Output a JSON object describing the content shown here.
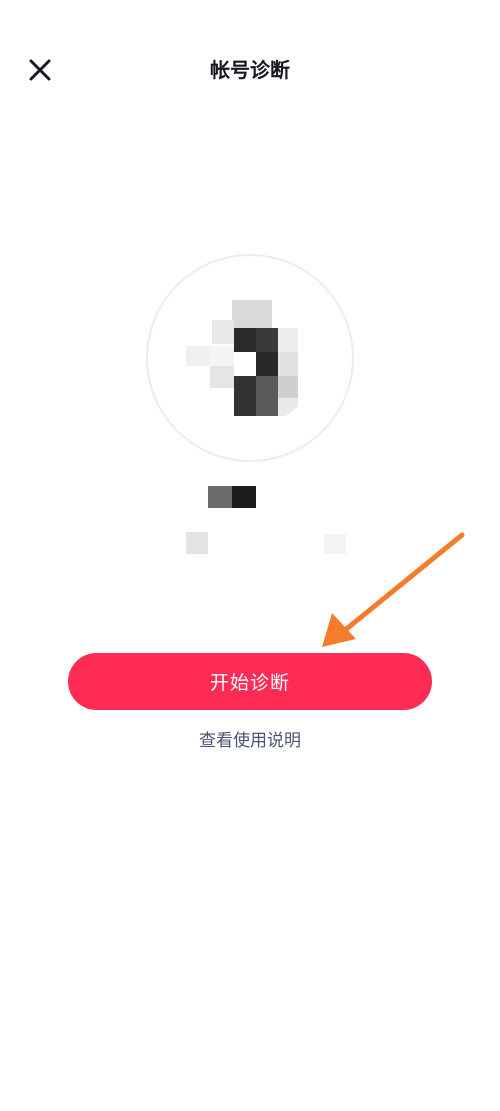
{
  "nav": {
    "close_icon": "close-icon",
    "title": "帐号诊断"
  },
  "profile": {
    "avatar_note": "pixelated",
    "username": "",
    "info": ""
  },
  "actions": {
    "start_label": "开始诊断",
    "help_label": "查看使用说明"
  },
  "colors": {
    "primary": "#fe2c55",
    "title": "#161823",
    "link": "#4a5372",
    "arrow": "#f47c2c"
  }
}
